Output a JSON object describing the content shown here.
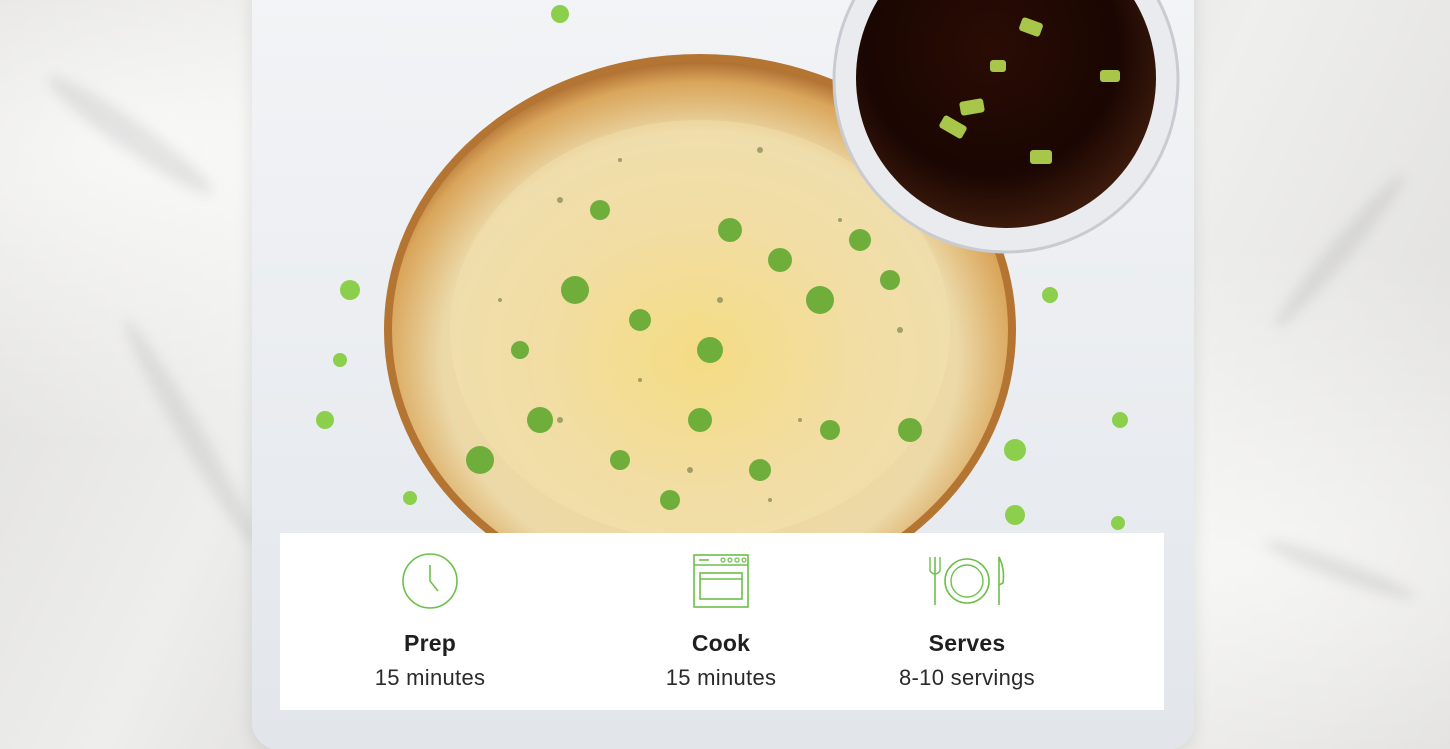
{
  "recipe_info": {
    "prep": {
      "icon": "clock-icon",
      "label": "Prep",
      "value": "15 minutes"
    },
    "cook": {
      "icon": "oven-icon",
      "label": "Cook",
      "value": "15 minutes"
    },
    "serves": {
      "icon": "plate-cutlery-icon",
      "label": "Serves",
      "value": "8-10 servings"
    }
  },
  "colors": {
    "icon_green": "#6cc04a",
    "card_background": "#ffffff",
    "text": "#1f1f1f"
  }
}
